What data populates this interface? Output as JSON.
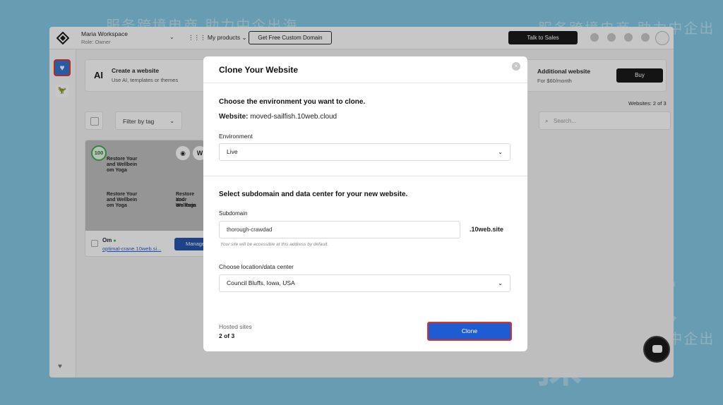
{
  "watermark": {
    "brand": "主机侦探",
    "slogan": "服务跨境电商 助力中企出海"
  },
  "topbar": {
    "workspace_name": "Maria Workspace",
    "workspace_role": "Role: Owner",
    "products_label": "My products",
    "free_domain_label": "Get Free Custom Domain",
    "talk_sales_label": "Talk to Sales"
  },
  "banner": {
    "ai_badge": "AI",
    "create_title": "Create a website",
    "create_subtitle": "Use AI, templates or themes",
    "additional_title": "Additional website",
    "additional_subtitle": "For $60/month",
    "buy_label": "Buy"
  },
  "websites_count": "Websites: 2 of 3",
  "toolbar": {
    "filter_label": "Filter by tag",
    "search_placeholder": "Search..."
  },
  "card": {
    "score": "100",
    "thumb_lines": [
      "Restore Your",
      "and Wellbein",
      "om Yoga"
    ],
    "name": "Om",
    "url": "optimal-crane.10web.si...",
    "manage_label": "Manage"
  },
  "modal": {
    "title": "Clone Your Website",
    "choose_env_heading": "Choose the environment you want to clone.",
    "website_label": "Website:",
    "website_value": "moved-sailfish.10web.cloud",
    "environment_label": "Environment",
    "environment_value": "Live",
    "subdomain_heading": "Select subdomain and data center for your new website.",
    "subdomain_label": "Subdomain",
    "subdomain_value": "thorough-crawdad",
    "subdomain_suffix": ".10web.site",
    "subdomain_hint": "Your site will be accessible at this address by default.",
    "location_label": "Choose location/data center",
    "location_value": "Council Bluffs, Iowa, USA",
    "hosted_label": "Hosted sites",
    "hosted_value": "2 of 3",
    "clone_label": "Clone"
  },
  "icons": {
    "close": "×",
    "chevron": "⌄",
    "search": "⌕",
    "heart": "♥",
    "eye": "◉"
  },
  "colors": {
    "primary_blue": "#1f5cd1",
    "highlight_red": "#d9322a",
    "dark_button": "#111111"
  }
}
